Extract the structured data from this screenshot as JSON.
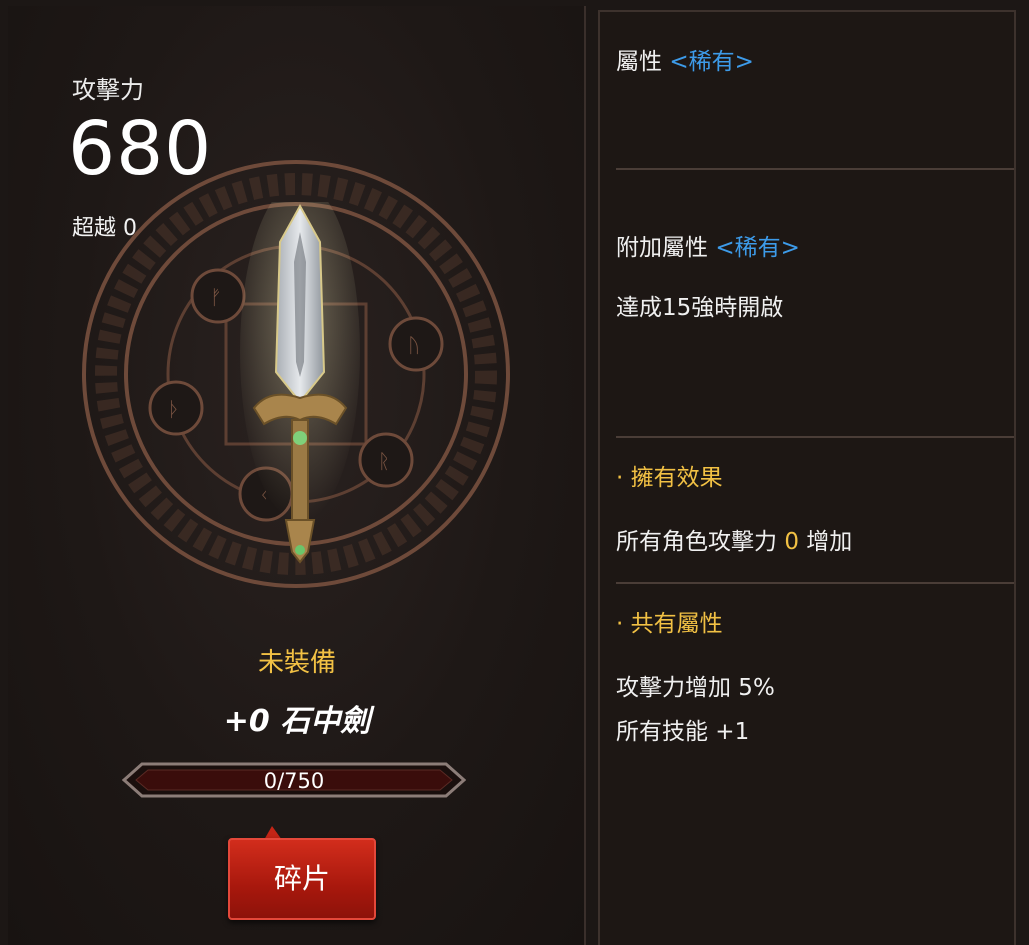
{
  "item": {
    "attack_label": "攻擊力",
    "attack_value": "680",
    "transcend_text": "超越 0",
    "equip_status": "未裝備",
    "name": "+0 石中劍",
    "progress_text": "0/750",
    "progress_fraction": 0,
    "shard_button_label": "碎片"
  },
  "attributes": {
    "title": "屬性",
    "rarity": "<稀有>"
  },
  "additional_attributes": {
    "title": "附加屬性",
    "rarity": "<稀有>",
    "note": "達成15強時開啟"
  },
  "possession_effect": {
    "title": "· 擁有效果",
    "line_prefix": "所有角色攻擊力",
    "line_value": "0",
    "line_suffix": "增加"
  },
  "shared_attributes": {
    "title": "· 共有屬性",
    "lines": [
      "攻擊力增加 5%",
      "所有技能 +1"
    ]
  },
  "colors": {
    "gold": "#f2c144",
    "rarity_blue": "#3d9be9",
    "button_red": "#b81e10"
  }
}
